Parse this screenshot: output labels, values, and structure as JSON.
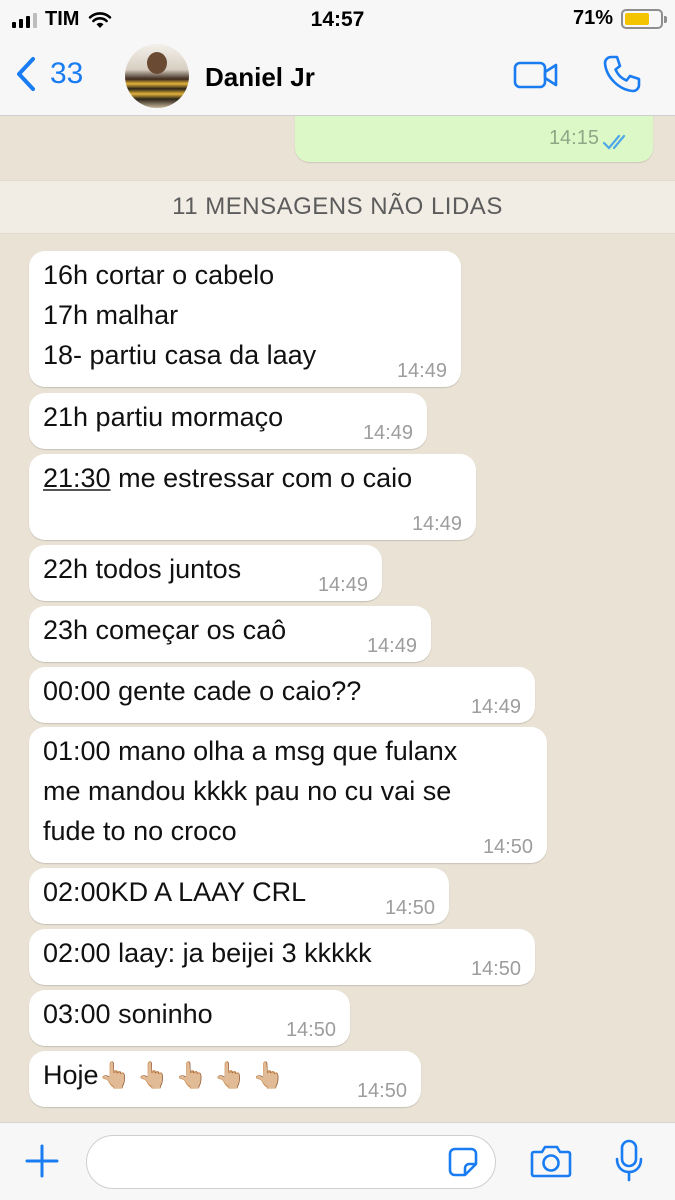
{
  "status_bar": {
    "carrier": "TIM",
    "time": "14:57",
    "battery": "71%",
    "battery_level": 0.71
  },
  "header": {
    "back_count": "33",
    "contact_name": "Daniel Jr"
  },
  "chat": {
    "outgoing_time": "14:15",
    "unread_banner": "11 MENSAGENS NÃO LIDAS",
    "messages": [
      {
        "text": "16h cortar o cabelo\n17h malhar\n18- partiu casa da laay",
        "time": "14:49"
      },
      {
        "text": "21h partiu mormaço",
        "time": "14:49"
      },
      {
        "text_underlined": "21:30",
        "text": " me estressar com o caio",
        "time": "14:49"
      },
      {
        "text": "22h todos juntos",
        "time": "14:49"
      },
      {
        "text": "23h começar os caô",
        "time": "14:49"
      },
      {
        "text": "00:00 gente cade o caio??",
        "time": "14:49"
      },
      {
        "text": "01:00 mano olha a msg que fulanx\nme mandou kkkk pau no cu vai se\nfude to no croco",
        "time": "14:50"
      },
      {
        "text": "02:00KD A LAAY CRL",
        "time": "14:50"
      },
      {
        "text": "02:00 laay: ja beijei 3 kkkkk",
        "time": "14:50"
      },
      {
        "text": "03:00 soninho",
        "time": "14:50"
      },
      {
        "text": "Hoje",
        "emoji": "👆🏼👆🏼👆🏼👆🏼👆🏼",
        "time": "14:50"
      }
    ]
  },
  "input": {
    "placeholder": ""
  },
  "colors": {
    "accent": "#1a7cf2",
    "outgoing_bubble": "#dcf8c6",
    "chat_background": "#e9e2d5",
    "battery": "#f5c400"
  }
}
